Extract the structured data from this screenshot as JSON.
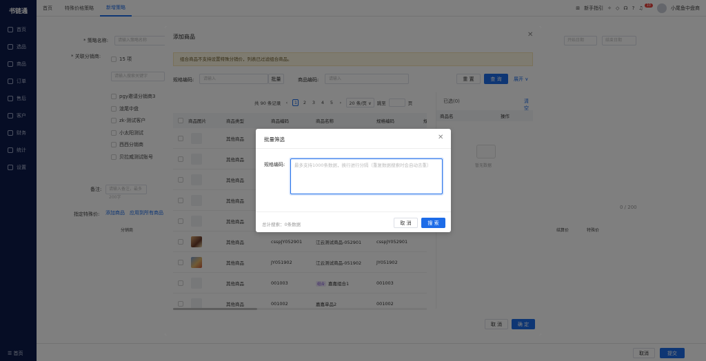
{
  "sidebar": {
    "logo": "书链通",
    "items": [
      {
        "label": "首页"
      },
      {
        "label": "选品"
      },
      {
        "label": "商品"
      },
      {
        "label": "订单"
      },
      {
        "label": "售后"
      },
      {
        "label": "客户"
      },
      {
        "label": "财务"
      },
      {
        "label": "统计"
      },
      {
        "label": "设置"
      }
    ],
    "bottom": "☰ 首页"
  },
  "topbar": {
    "tabs": [
      {
        "label": "首页"
      },
      {
        "label": "特殊价格策略"
      },
      {
        "label": "新增策略"
      }
    ],
    "guide": "新手指引",
    "badge": "10",
    "user": "小尾鱼中盘商"
  },
  "bg": {
    "strategy_label": "* 策略名称:",
    "strategy_placeholder": "请输入策略名称",
    "dist_label": "* 关联分销商:",
    "dist_count": "15 项",
    "dist_search": "请输入搜索关键字",
    "dist_items": [
      "pgy邀请分销商3",
      "渲尾中盘",
      "zk-测试客户",
      "小太阳测试",
      "西西分销商",
      "贝拉威测试账号"
    ],
    "start_date": "开始日期",
    "end_date": "结束日期",
    "note_label": "备注:",
    "note_placeholder": "请输入备注，最多200字",
    "counter": "0 / 200",
    "special_label": "指定特殊价:",
    "add_goods": "添加商品",
    "batch_apply": "应用到所有商品",
    "col_dist": "分销商",
    "col_settle": "结算价",
    "col_special": "特殊价",
    "cancel": "取消",
    "submit": "提交"
  },
  "modal": {
    "title": "添加商品",
    "notice": "组合商品不支持设置特殊分销价，列表已过滤组合商品。",
    "spec_label": "规格编码:",
    "spec_placeholder": "请输入",
    "batch_btn": "批量",
    "goods_label": "商品编码:",
    "goods_placeholder": "请输入",
    "reset": "重 置",
    "query": "查 询",
    "expand": "展开 ∨",
    "pager": {
      "total": "共 90 条记录",
      "prev": "‹",
      "pages": [
        "1",
        "2",
        "3",
        "4",
        "5"
      ],
      "next": "›",
      "size": "20 条/页 ∨",
      "goto": "跳至",
      "page": "页"
    },
    "table": {
      "headers": [
        "商品图片",
        "商品类型",
        "商品编码",
        "商品名称",
        "规格编码",
        "规"
      ],
      "rows": [
        {
          "type": "其他商品",
          "code": "",
          "name": "",
          "spec": ""
        },
        {
          "type": "其他商品",
          "code": "",
          "name": "",
          "spec": ""
        },
        {
          "type": "其他商品",
          "code": "",
          "name": "",
          "spec": ""
        },
        {
          "type": "其他商品",
          "code": "",
          "name": "",
          "spec": ""
        },
        {
          "type": "其他商品",
          "code": "",
          "name": "",
          "spec": ""
        },
        {
          "type": "其他商品",
          "code": "csspJY052901",
          "name": "江云测试商品-052901",
          "spec": "csspJY052901"
        },
        {
          "type": "其他商品",
          "code": "JY051902",
          "name": "江云测试商品-051902",
          "spec": "JY051902"
        },
        {
          "type": "其他商品",
          "code": "001003",
          "tag": "组合",
          "name": "嘉嘉组合1",
          "spec": "001003"
        },
        {
          "type": "其他商品",
          "code": "001002",
          "name": "嘉嘉单品2",
          "spec": "001002"
        }
      ]
    },
    "right": {
      "selected": "已选(0)",
      "clear": "清空",
      "col_name": "商品名",
      "col_op": "操作",
      "empty": "暂无数据"
    },
    "cancel": "取 消",
    "confirm": "确 定"
  },
  "sub": {
    "title": "批量筛选",
    "label": "规格编码:",
    "placeholder": "最多支持1000条数据，换行进行分隔（重复数据搜索时会自动去重）",
    "total": "总计搜索：0条数据",
    "cancel": "取 消",
    "search": "搜 索"
  },
  "colors": {
    "primary": "#1d6ce8",
    "sidebar": "#0c1a4a"
  }
}
